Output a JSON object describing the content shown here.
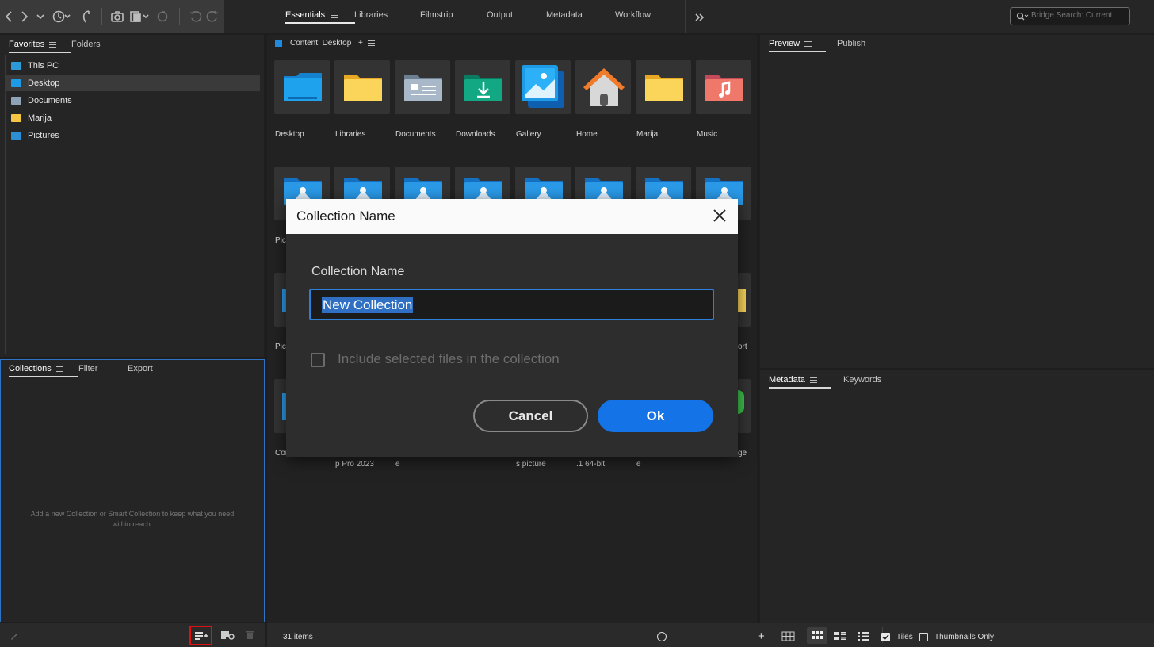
{
  "search": {
    "placeholder": "Bridge Search: Current"
  },
  "workspace_tabs": [
    "Essentials",
    "Libraries",
    "Filmstrip",
    "Output",
    "Metadata",
    "Workflow"
  ],
  "favorites_panel": {
    "tabs": [
      "Favorites",
      "Folders"
    ],
    "items": [
      "This PC",
      "Desktop",
      "Documents",
      "Marija",
      "Pictures"
    ],
    "selected": "Desktop"
  },
  "collections_panel": {
    "tabs": [
      "Collections",
      "Filter",
      "Export"
    ],
    "empty_message_line1": "Add a new Collection or Smart Collection to keep what you need",
    "empty_message_line2": "within reach."
  },
  "content_panel": {
    "header": "Content: Desktop",
    "row1_labels": [
      "Desktop",
      "Libraries",
      "Documents",
      "Downloads",
      "Gallery",
      "Home",
      "Marija",
      "Music"
    ],
    "partial_labels": {
      "row2_left": "Pic",
      "row3_left": "Pic",
      "row3_right": "ort",
      "row4_left": "Cor",
      "row4_right": "ge",
      "row4_sub": [
        "p Pro 2023",
        "e",
        "s picture",
        ".1 64-bit",
        "e"
      ]
    },
    "item_count": "31 items"
  },
  "preview_panel": {
    "tabs": [
      "Preview",
      "Publish"
    ]
  },
  "metadata_panel": {
    "tabs": [
      "Metadata",
      "Keywords"
    ]
  },
  "view_options": {
    "tiles_label": "Tiles",
    "tiles_checked": true,
    "thumbs_only_label": "Thumbnails Only",
    "thumbs_only_checked": false,
    "zoom_level": 0
  },
  "dialog": {
    "title": "Collection Name",
    "field_label": "Collection Name",
    "input_value": "New Collection",
    "checkbox_label": "Include selected files in the collection",
    "checkbox_checked": false,
    "cancel_label": "Cancel",
    "ok_label": "Ok"
  },
  "colors": {
    "accent": "#1473e6",
    "highlight_box": "#e01010"
  }
}
